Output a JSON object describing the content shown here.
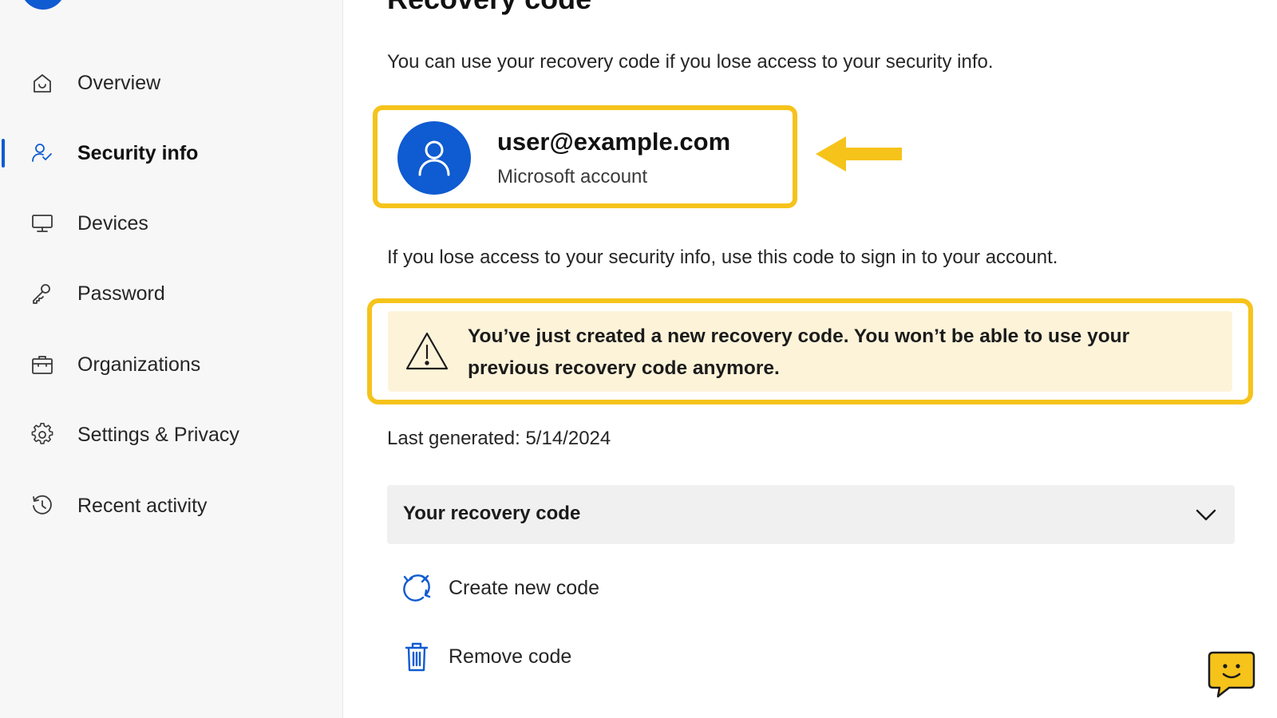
{
  "sidebar": {
    "items": [
      {
        "label": "Overview",
        "icon": "home-icon"
      },
      {
        "label": "Security info",
        "icon": "security-info-icon",
        "active": true
      },
      {
        "label": "Devices",
        "icon": "monitor-icon"
      },
      {
        "label": "Password",
        "icon": "key-icon"
      },
      {
        "label": "Organizations",
        "icon": "briefcase-icon"
      },
      {
        "label": "Settings & Privacy",
        "icon": "gear-icon"
      },
      {
        "label": "Recent activity",
        "icon": "history-icon"
      }
    ]
  },
  "main": {
    "title": "Recovery code",
    "intro": "You can use your recovery code if you lose access to your security info.",
    "account": {
      "email": "user@example.com",
      "type": "Microsoft account"
    },
    "lose_text": "If you lose access to your security info, use this code to sign in to your account.",
    "warning": "You’ve just created a new recovery code. You won’t be able to use your previous recovery code anymore.",
    "last_generated": "Last generated: 5/14/2024",
    "dropdown_label": "Your recovery code",
    "actions": {
      "create": "Create new code",
      "remove": "Remove code"
    }
  },
  "colors": {
    "accent": "#0f5bd1",
    "highlight": "#f6c31b",
    "warning_bg": "#fdf3d9",
    "sidebar_bg": "#f7f7f7"
  }
}
